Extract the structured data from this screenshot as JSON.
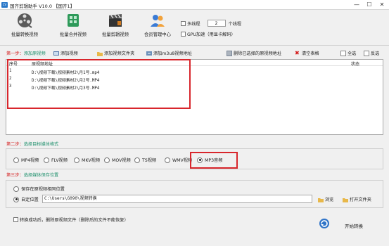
{
  "window": {
    "logo_text": "CV",
    "title": "国齐剪辑助手 V10.0 【国齐1】",
    "min": "—",
    "max": "☐",
    "close": "✕"
  },
  "toolbar": {
    "batch_convert": "批量转换视频",
    "batch_merge": "批量合并视频",
    "batch_cut": "批量剪辑视频",
    "member": "会员管理中心",
    "multithread_label": "多线程",
    "threads_value": "2",
    "threads_unit": "个线程",
    "gpu_label": "GPU加速（用显卡解码）"
  },
  "step1": {
    "prefix": "第一步：",
    "text": "添加原视频",
    "add_video": "添加视频",
    "add_folder": "添加视频文件夹",
    "add_m3u8": "添加m3u8视频地址",
    "delete_selected": "删除已选择的原视频地址",
    "clear_table": "清空表格",
    "select_all": "全选",
    "invert": "反选"
  },
  "table": {
    "headers": [
      "序号",
      "原视频地址",
      "状态"
    ],
    "rows": [
      {
        "no": "1",
        "path": "D:\\视频下载\\视频素材2\\月1号.mp4"
      },
      {
        "no": "2",
        "path": "D:\\视频下载\\视频素材2\\月2号.MP4"
      },
      {
        "no": "3",
        "path": "D:\\视频下载\\视频素材2\\月3号.MP4"
      }
    ]
  },
  "step2": {
    "prefix": "第二步：",
    "text": "选择目标媒体格式",
    "formats": [
      "MP4视频",
      "FLV视频",
      "MKV视频",
      "MOV视频",
      "TS视频",
      "WMV视频",
      "MP3音频"
    ],
    "selected_index": 6
  },
  "step3": {
    "prefix": "第三步：",
    "text": "选择媒体保存位置",
    "save_original": "保存在原视频相同位置",
    "custom_location": "自定位置",
    "path": "C:\\Users\\G090\\视频转换",
    "browse": "浏览",
    "open_folder": "打开文件夹"
  },
  "footer": {
    "delete_after": "转换成功后，删除原视频文件（删除后的文件不能恢复）",
    "start": "开始转换"
  },
  "colors": {
    "step_prefix": "#d42020",
    "step_text": "#1d8f6b",
    "highlight": "#d8262c"
  }
}
